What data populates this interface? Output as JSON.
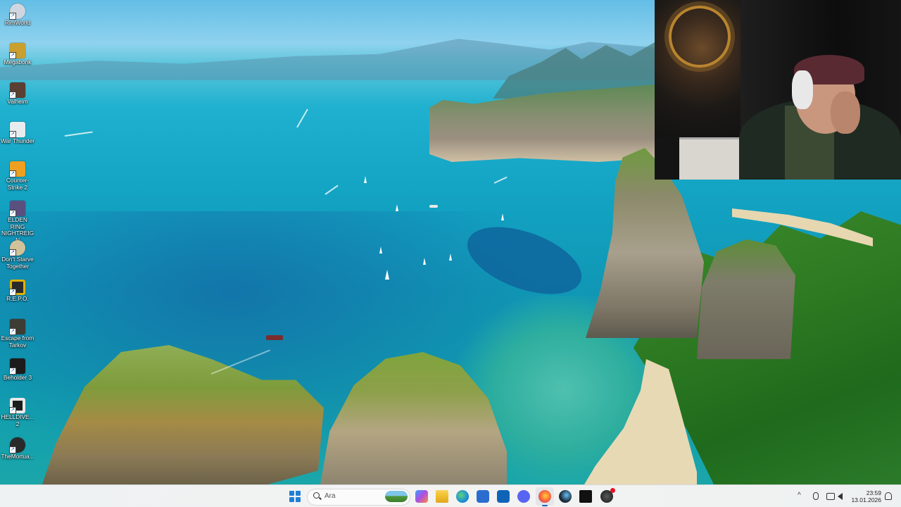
{
  "desktop": {
    "icons": [
      {
        "label": "RimWorld",
        "color": "#cfd6e0"
      },
      {
        "label": "Megabonk",
        "color": "#c9a030"
      },
      {
        "label": "Valheim",
        "color": "#5a4032"
      },
      {
        "label": "War Thunder",
        "color": "#e9ecef"
      },
      {
        "label": "Counter-Strike 2",
        "color": "#f0a020"
      },
      {
        "label": "ELDEN RING NIGHTREIGN",
        "color": "#5a5080"
      },
      {
        "label": "Don't Starve Together",
        "color": "#d2c29a"
      },
      {
        "label": "R.E.P.O.",
        "color": "#2a2a2a"
      },
      {
        "label": "Escape from Tarkov",
        "color": "#3d3d35"
      },
      {
        "label": "Beholder 3",
        "color": "#1c1c1c"
      },
      {
        "label": "HELLDIVE... 2",
        "color": "#1c1c1c"
      },
      {
        "label": "TheMortua...",
        "color": "#2a2a2a"
      }
    ]
  },
  "taskbar": {
    "search": {
      "placeholder": "Ara"
    },
    "apps": [
      {
        "name": "copilot-app-icon",
        "color": "#7b4fd6"
      },
      {
        "name": "file-explorer-icon",
        "color": "#f2c230"
      },
      {
        "name": "edge-browser-icon",
        "color": "#1b8fd8"
      },
      {
        "name": "microsoft-store-icon",
        "color": "#2b6ccf"
      },
      {
        "name": "outlook-icon",
        "color": "#1064b8"
      },
      {
        "name": "discord-icon",
        "color": "#5865f2"
      },
      {
        "name": "firefox-icon",
        "color": "#ff7139"
      },
      {
        "name": "steam-icon",
        "color": "#1b2838"
      },
      {
        "name": "epic-games-icon",
        "color": "#111111"
      },
      {
        "name": "obs-studio-icon",
        "color": "#2a2a2a"
      }
    ],
    "clock": {
      "time": "23:59",
      "date": "13.01.2026"
    }
  }
}
